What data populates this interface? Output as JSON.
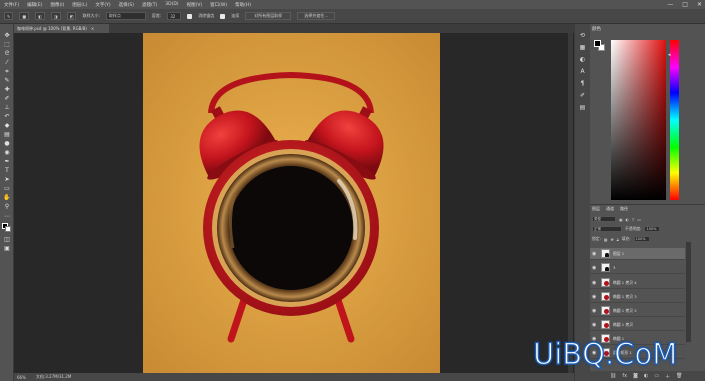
{
  "menubar": {
    "items": [
      "文件(F)",
      "编辑(E)",
      "图像(I)",
      "图层(L)",
      "文字(Y)",
      "选择(S)",
      "滤镜(T)",
      "3D(D)",
      "视图(V)",
      "窗口(W)",
      "帮助(H)"
    ],
    "window_controls": [
      "—",
      "□",
      "✕"
    ]
  },
  "optionsbar": {
    "sample_size_label": "取样大小:",
    "sample_size_value": "取样点",
    "tolerance_label": "容差:",
    "tolerance_value": "32",
    "antialias_label": "消除锯齿",
    "contiguous_label": "连续",
    "all_layers_label": "对所有图层取样",
    "select_subject_label": "选择并遮住..."
  },
  "document": {
    "tab_label": "咖啡闹钟.psd @ 100% (背景, RGB/8)",
    "tab_close": "×"
  },
  "statusbar": {
    "zoom": "66%",
    "doc_info": "文档:3.27M/31.2M"
  },
  "color_panel": {
    "tab_label": "颜色",
    "foreground": "#000000",
    "background": "#ffffff"
  },
  "layers_panel": {
    "tabs": [
      "图层",
      "通道",
      "路径"
    ],
    "filter_label": "类型",
    "blend_mode": "正常",
    "opacity_label": "不透明度:",
    "opacity_value": "100%",
    "lock_label": "锁定:",
    "fill_label": "填充:",
    "fill_value": "100%",
    "layers": [
      {
        "name": "图层 1"
      },
      {
        "name": "3"
      },
      {
        "name": "椭圆 1 拷贝 4"
      },
      {
        "name": "椭圆 1 拷贝 3"
      },
      {
        "name": "椭圆 1 拷贝 2"
      },
      {
        "name": "椭圆 1 拷贝"
      },
      {
        "name": "椭圆 1"
      },
      {
        "name": "圆角矩形 1"
      }
    ]
  },
  "watermark": {
    "text": "UiBQ.CoM"
  },
  "colors": {
    "menubar_bg": "#535353",
    "workspace_bg": "#282828",
    "canvas_bg": "#dba042",
    "clock_red": "#c0141d",
    "coffee": "#0d0a09",
    "watermark_stroke": "#1b5fb8"
  }
}
